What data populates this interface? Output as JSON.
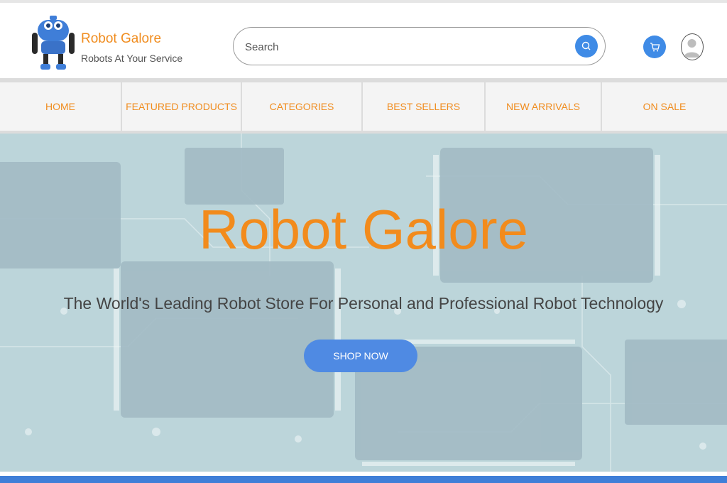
{
  "header": {
    "brand_title": "Robot Galore",
    "brand_tagline": "Robots At Your Service",
    "logo_icon": "robot-logo-icon"
  },
  "search": {
    "placeholder": "Search",
    "button_icon": "search-icon"
  },
  "actions": {
    "cart_icon": "cart-icon",
    "account_icon": "user-avatar-icon"
  },
  "nav": {
    "items": [
      {
        "label": "HOME"
      },
      {
        "label": "FEATURED PRODUCTS"
      },
      {
        "label": "CATEGORIES"
      },
      {
        "label": "BEST SELLERS"
      },
      {
        "label": "NEW ARRIVALS"
      },
      {
        "label": "ON SALE"
      }
    ]
  },
  "hero": {
    "title": "Robot Galore",
    "subtitle": "The  World's Leading Robot Store For Personal and Professional Robot Technology",
    "cta_label": "SHOP NOW"
  },
  "colors": {
    "accent_orange": "#f08c1e",
    "accent_blue": "#3f8be6"
  }
}
